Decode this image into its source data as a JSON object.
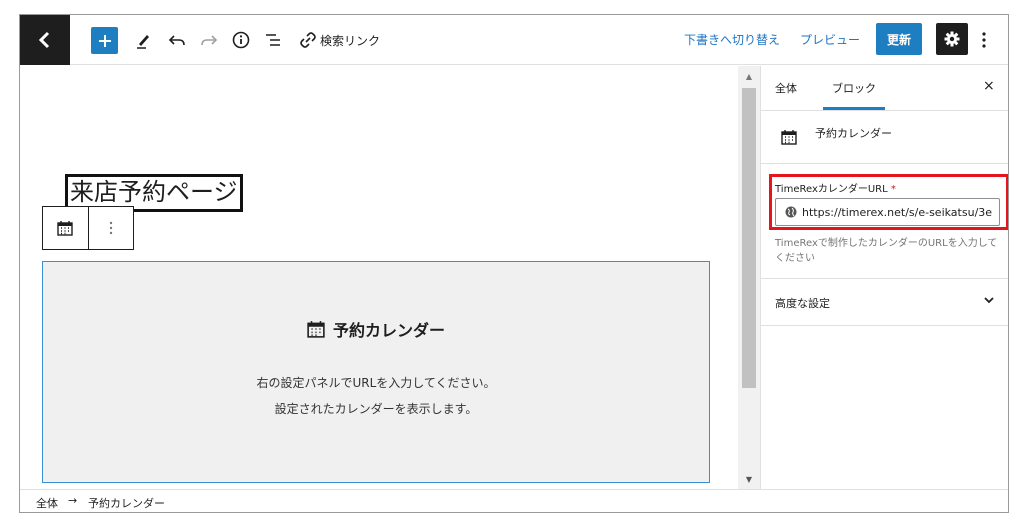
{
  "toolbar": {
    "search_link_label": "検索リンク",
    "draft_label": "下書きへ切り替え",
    "preview_label": "プレビュー",
    "update_label": "更新"
  },
  "editor": {
    "page_title": "来店予約ページ",
    "placeholder": {
      "title": "予約カレンダー",
      "line1": "右の設定パネルでURLを入力してください。",
      "line2": "設定されたカレンダーを表示します。"
    }
  },
  "sidebar": {
    "tabs": [
      {
        "label": "全体",
        "active": false
      },
      {
        "label": "ブロック",
        "active": true
      }
    ],
    "close_symbol": "×",
    "block_name": "予約カレンダー",
    "url_field": {
      "label": "TimeRexカレンダーURL",
      "required_mark": "*",
      "value": "https://timerex.net/s/e-seikatsu/3e",
      "help": "TimeRexで制作したカレンダーのURLを入力してください"
    },
    "advanced_label": "高度な設定"
  },
  "breadcrumb": {
    "root": "全体",
    "separator": "→",
    "current": "予約カレンダー"
  },
  "colors": {
    "accent": "#1d7ec2",
    "highlight": "#e4161b",
    "dark": "#1e1e1e"
  },
  "icons": [
    "back-chevron-icon",
    "plus-icon",
    "pencil-icon",
    "undo-icon",
    "redo-icon",
    "info-icon",
    "list-view-icon",
    "link-icon",
    "gear-icon",
    "kebab-icon",
    "calendar-icon",
    "globe-icon",
    "chevron-down-icon"
  ]
}
